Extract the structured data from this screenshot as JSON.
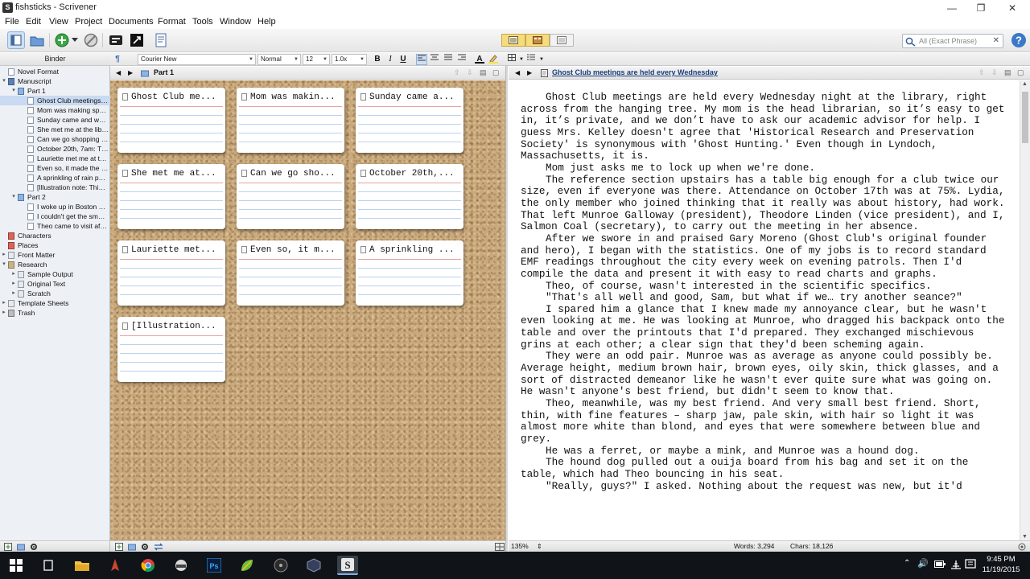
{
  "window": {
    "title": "fishsticks - Scrivener"
  },
  "menu": [
    "File",
    "Edit",
    "View",
    "Project",
    "Documents",
    "Format",
    "Tools",
    "Window",
    "Help"
  ],
  "toolbar": {
    "search_placeholder": "All (Exact Phrase)"
  },
  "format_bar": {
    "font": "Courier New",
    "style": "Normal",
    "size": "12",
    "line_spacing": "1.0x",
    "bold": "B",
    "italic": "I",
    "underline": "U"
  },
  "binder": {
    "header": "Binder",
    "items": [
      {
        "label": "Novel Format",
        "level": 0,
        "icon": "doc",
        "twisty": ""
      },
      {
        "label": "Manuscript",
        "level": 0,
        "icon": "draft",
        "twisty": "▾"
      },
      {
        "label": "Part 1",
        "level": 1,
        "icon": "folder-blue",
        "twisty": "▾"
      },
      {
        "label": "Ghost Club meetings are...",
        "level": 2,
        "icon": "doc",
        "twisty": "",
        "selected": true
      },
      {
        "label": "Mom was making spagh...",
        "level": 2,
        "icon": "doc",
        "twisty": ""
      },
      {
        "label": "Sunday came and went l...",
        "level": 2,
        "icon": "doc",
        "twisty": ""
      },
      {
        "label": "She met me at the librar...",
        "level": 2,
        "icon": "doc",
        "twisty": ""
      },
      {
        "label": "Can we go shopping to...",
        "level": 2,
        "icon": "doc",
        "twisty": ""
      },
      {
        "label": "October 20th, 7am: The...",
        "level": 2,
        "icon": "doc",
        "twisty": ""
      },
      {
        "label": "Lauriette met me at the ...",
        "level": 2,
        "icon": "doc",
        "twisty": ""
      },
      {
        "label": "Even so, it made the dri...",
        "level": 2,
        "icon": "doc",
        "twisty": ""
      },
      {
        "label": "A sprinkling of rain pulle...",
        "level": 2,
        "icon": "doc",
        "twisty": ""
      },
      {
        "label": "[Illustration note: This p...",
        "level": 2,
        "icon": "doc",
        "twisty": ""
      },
      {
        "label": "Part 2",
        "level": 1,
        "icon": "folder-blue",
        "twisty": "▾"
      },
      {
        "label": "I woke up in Boston Gen...",
        "level": 2,
        "icon": "doc",
        "twisty": ""
      },
      {
        "label": "I couldn't get the smell o...",
        "level": 2,
        "icon": "doc",
        "twisty": ""
      },
      {
        "label": "Theo came to visit after ...",
        "level": 2,
        "icon": "doc",
        "twisty": ""
      },
      {
        "label": "Characters",
        "level": 0,
        "icon": "red",
        "twisty": ""
      },
      {
        "label": "Places",
        "level": 0,
        "icon": "red",
        "twisty": ""
      },
      {
        "label": "Front Matter",
        "level": 0,
        "icon": "folder",
        "twisty": "▸"
      },
      {
        "label": "Research",
        "level": 0,
        "icon": "tan",
        "twisty": "▾"
      },
      {
        "label": "Sample Output",
        "level": 1,
        "icon": "folder",
        "twisty": "▸"
      },
      {
        "label": "Original Text",
        "level": 1,
        "icon": "folder",
        "twisty": "▸"
      },
      {
        "label": "Scratch",
        "level": 1,
        "icon": "folder",
        "twisty": "▸"
      },
      {
        "label": "Template Sheets",
        "level": 0,
        "icon": "folder",
        "twisty": "▸"
      },
      {
        "label": "Trash",
        "level": 0,
        "icon": "gray",
        "twisty": "▸"
      }
    ]
  },
  "corkboard": {
    "title": "Part 1",
    "cards": [
      "Ghost Club me...",
      "Mom was makin...",
      "Sunday came a...",
      "She met me at...",
      "Can we go sho...",
      "October 20th,...",
      "Lauriette met...",
      "Even so, it m...",
      "A sprinkling ...",
      "[Illustration..."
    ]
  },
  "document": {
    "title": "Ghost Club meetings are held every Wednesday",
    "paragraphs": [
      "Ghost Club meetings are held every Wednesday night at the library, right across from the hanging tree. My mom is the head librarian, so it’s easy to get in, it’s private, and we don’t have to ask our academic advisor for help. I guess Mrs. Kelley doesn't agree that 'Historical Research and Preservation Society' is synonymous with 'Ghost Hunting.' Even though in Lyndoch, Massachusetts, it is.",
      "Mom just asks me to lock up when we're done.",
      "The reference section upstairs has a table big enough for a club twice our size, even if everyone was there. Attendance on October 17th was at 75%. Lydia, the only member who joined thinking that it really was about history, had work. That left Munroe Galloway (president), Theodore Linden (vice president), and I, Salmon Coal (secretary), to carry out the meeting in her absence.",
      "After we swore in and praised Gary Moreno (Ghost Club's original founder and hero), I began with the statistics. One of my jobs is to record standard EMF readings throughout the city every week on evening patrols. Then I'd compile the data and present it with easy to read charts and graphs.",
      "Theo, of course, wasn't interested in the scientific specifics.",
      "\"That's all well and good, Sam, but what if we… try another seance?\"",
      "I spared him a glance that I knew made my annoyance clear, but he wasn't even looking at me. He was looking at Munroe, who dragged his backpack onto the table and over the printouts that I'd prepared. They exchanged mischievous grins at each other; a clear sign that they'd been scheming again.",
      "They were an odd pair. Munroe was as average as anyone could possibly be. Average height, medium brown hair, brown eyes, oily skin, thick glasses, and a sort of distracted demeanor like he wasn't ever quite sure what was going on. He wasn't anyone's best friend, but didn't seem to know that.",
      "Theo, meanwhile, was my best friend. And very small best friend. Short, thin, with fine features – sharp jaw, pale skin, with hair so light it was almost more white than blond, and eyes that were somewhere between blue and grey.",
      "He was a ferret, or maybe a mink, and Munroe was a hound dog.",
      "The hound dog pulled out a ouija board from his bag and set it on the table, which had Theo bouncing in his seat.",
      "\"Really, guys?\" I asked. Nothing about the request was new, but it'd"
    ]
  },
  "status": {
    "zoom": "135%",
    "words": "Words: 3,294",
    "chars": "Chars: 18,126"
  },
  "clock": {
    "time": "9:45 PM",
    "date": "11/19/2015"
  }
}
